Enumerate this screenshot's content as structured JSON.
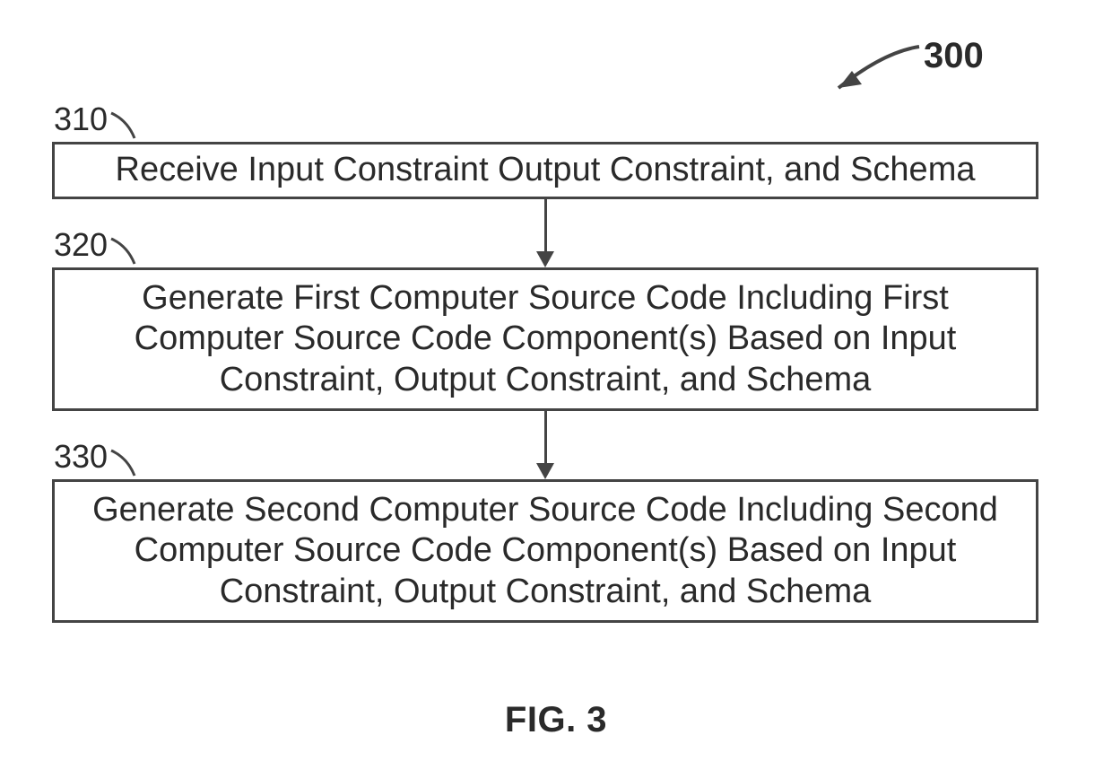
{
  "figure_caption": "FIG. 3",
  "figure_ref": "300",
  "steps": [
    {
      "ref": "310",
      "text": "Receive Input Constraint Output Constraint, and Schema"
    },
    {
      "ref": "320",
      "text": "Generate First Computer Source Code Including First Computer Source Code Component(s) Based on Input Constraint, Output Constraint, and Schema"
    },
    {
      "ref": "330",
      "text": "Generate Second Computer Source Code Including Second Computer Source Code Component(s) Based on Input Constraint, Output Constraint, and Schema"
    }
  ]
}
